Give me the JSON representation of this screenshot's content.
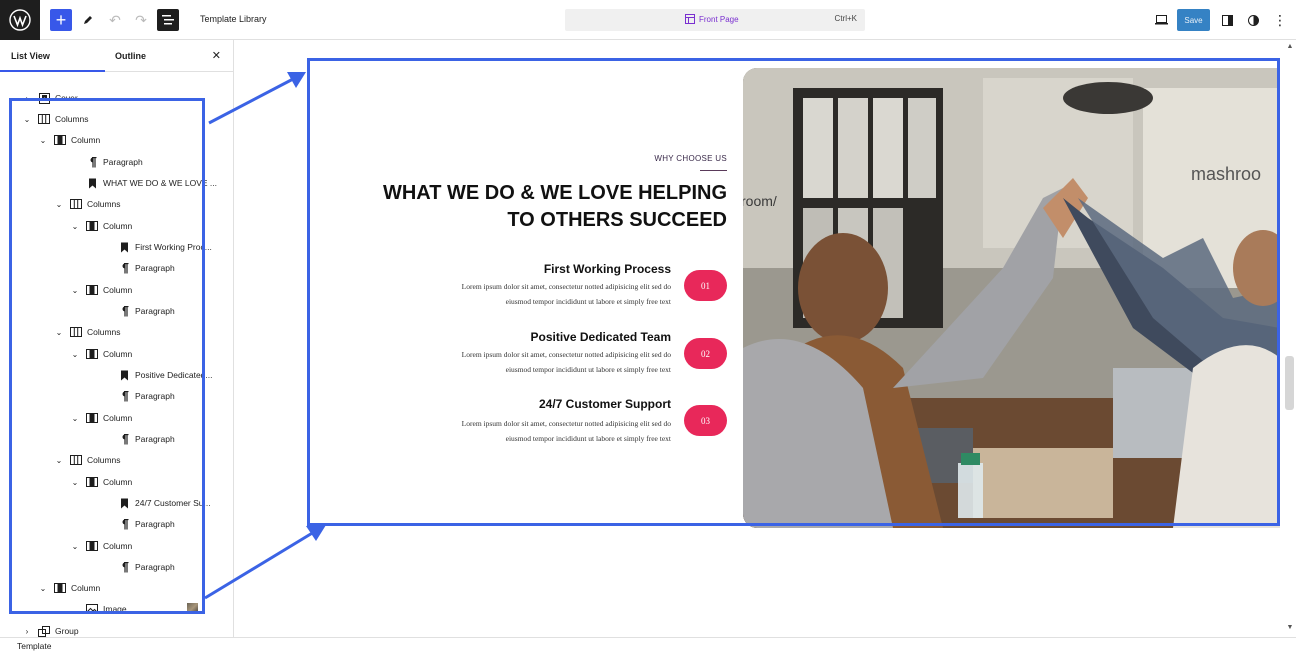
{
  "topbar": {
    "title": "Template Library",
    "page_name": "Front Page",
    "shortcut": "Ctrl+K",
    "save_label": "Save"
  },
  "sidebar": {
    "tab_list_view": "List View",
    "tab_outline": "Outline",
    "close_symbol": "✕",
    "tree": [
      {
        "label": "Cover",
        "icon": "cover-icon",
        "expanded": false
      },
      {
        "label": "Columns",
        "icon": "columns-icon",
        "expanded": true
      },
      {
        "label": "Column",
        "icon": "column-icon",
        "expanded": true
      },
      {
        "label": "Paragraph",
        "icon": "paragraph-icon"
      },
      {
        "label": "WHAT WE DO & WE LOVE ...",
        "icon": "heading-bookmark-icon"
      },
      {
        "label": "Columns",
        "icon": "columns-icon",
        "expanded": true
      },
      {
        "label": "Column",
        "icon": "column-icon",
        "expanded": true
      },
      {
        "label": "First Working Proc...",
        "icon": "heading-bookmark-icon"
      },
      {
        "label": "Paragraph",
        "icon": "paragraph-icon"
      },
      {
        "label": "Column",
        "icon": "column-icon",
        "expanded": true
      },
      {
        "label": "Paragraph",
        "icon": "paragraph-icon"
      },
      {
        "label": "Columns",
        "icon": "columns-icon",
        "expanded": true
      },
      {
        "label": "Column",
        "icon": "column-icon",
        "expanded": true
      },
      {
        "label": "Positive Dedicated...",
        "icon": "heading-bookmark-icon"
      },
      {
        "label": "Paragraph",
        "icon": "paragraph-icon"
      },
      {
        "label": "Column",
        "icon": "column-icon",
        "expanded": true
      },
      {
        "label": "Paragraph",
        "icon": "paragraph-icon"
      },
      {
        "label": "Columns",
        "icon": "columns-icon",
        "expanded": true
      },
      {
        "label": "Column",
        "icon": "column-icon",
        "expanded": true
      },
      {
        "label": "24/7 Customer Su...",
        "icon": "heading-bookmark-icon"
      },
      {
        "label": "Paragraph",
        "icon": "paragraph-icon"
      },
      {
        "label": "Column",
        "icon": "column-icon",
        "expanded": true
      },
      {
        "label": "Paragraph",
        "icon": "paragraph-icon"
      },
      {
        "label": "Column",
        "icon": "column-icon",
        "expanded": true
      },
      {
        "label": "Image",
        "icon": "image-icon"
      },
      {
        "label": "Group",
        "icon": "group-icon",
        "expanded": false
      }
    ]
  },
  "content": {
    "eyebrow": "WHY CHOOSE US",
    "heading_line1": "WHAT WE DO & WE LOVE HELPING",
    "heading_line2": "TO OTHERS SUCCEED",
    "features": [
      {
        "title": "First Working Process",
        "text_line1": "Lorem ipsum dolor sit amet, consectetur notted adipisicing elit sed do",
        "text_line2": "eiusmod tempor incididunt ut labore et simply free text",
        "badge": "01"
      },
      {
        "title": "Positive Dedicated Team",
        "text_line1": "Lorem ipsum dolor sit amet, consectetur notted adipisicing elit sed do",
        "text_line2": "eiusmod tempor incididunt ut labore et simply free text",
        "badge": "02"
      },
      {
        "title": "24/7 Customer Support",
        "text_line1": "Lorem ipsum dolor sit amet, consectetur notted adipisicing elit sed do",
        "text_line2": "eiusmod tempor incididunt ut labore et simply free text",
        "badge": "03"
      }
    ],
    "photo_wall_text_left": "room/",
    "photo_wall_text_right": "mashroo"
  },
  "footer": {
    "label": "Template"
  },
  "colors": {
    "accent": "#3858e9",
    "badge": "#e8285a",
    "highlight": "#3b63e5",
    "save": "#3582c4"
  }
}
